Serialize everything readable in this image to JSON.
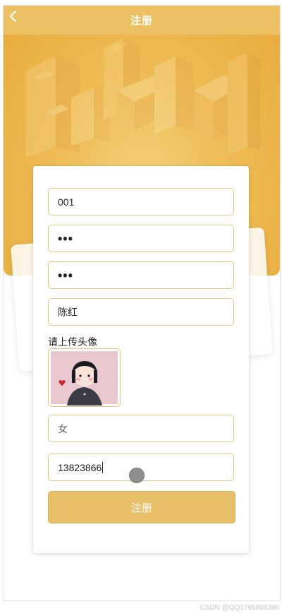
{
  "header": {
    "title": "注册",
    "back_icon": "chevron-left-icon"
  },
  "form": {
    "username": {
      "value": "001"
    },
    "password": {
      "value": "•••"
    },
    "confirm_password": {
      "value": "•••"
    },
    "name": {
      "value": "陈红"
    },
    "upload_label": "请上传头像",
    "gender": {
      "value": "女"
    },
    "phone": {
      "value": "13823866"
    },
    "submit_label": "注册"
  },
  "footer": {
    "watermark": "CSDN @QQ1795806396"
  },
  "colors": {
    "accent": "#ecc163",
    "border": "#e9c77e",
    "button": "#e9c06a"
  }
}
